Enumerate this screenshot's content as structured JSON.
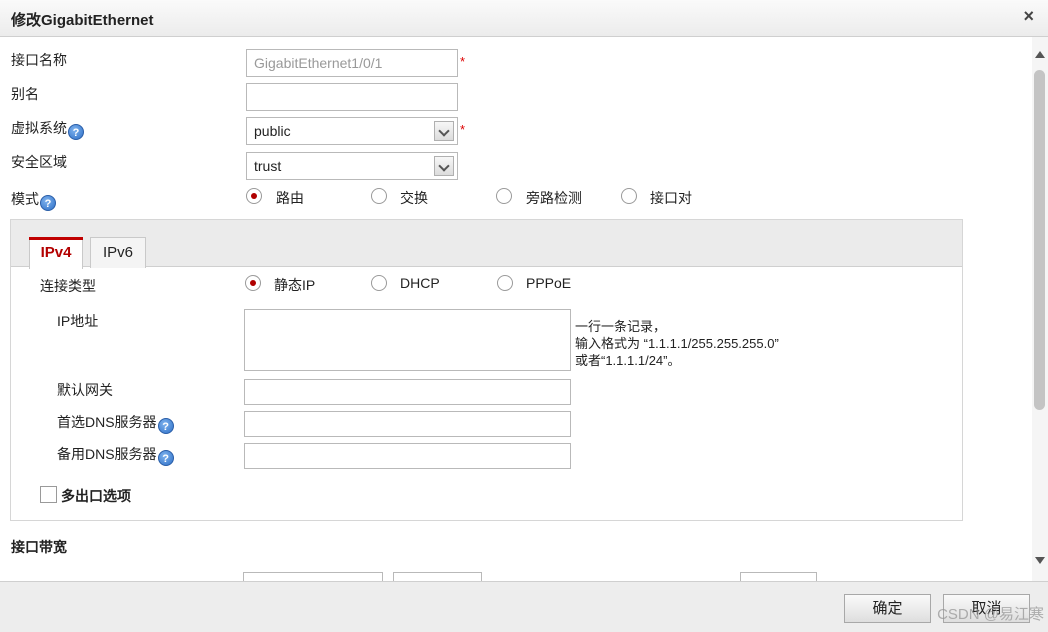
{
  "dialog": {
    "title": "修改GigabitEthernet",
    "close": "×"
  },
  "form": {
    "interface_name_label": "接口名称",
    "interface_name_value": "GigabitEthernet1/0/1",
    "alias_label": "别名",
    "alias_value": "",
    "vsys_label": "虚拟系统",
    "vsys_value": "public",
    "zone_label": "安全区域",
    "zone_value": "trust",
    "mode_label": "模式",
    "required_mark": "*",
    "help_glyph": "?",
    "mode_options": [
      "路由",
      "交换",
      "旁路检测",
      "接口对"
    ],
    "mode_selected": "路由"
  },
  "tabs": [
    {
      "label": "IPv4",
      "active": true
    },
    {
      "label": "IPv6",
      "active": false
    }
  ],
  "ipv4": {
    "conn_type_label": "连接类型",
    "conn_options": [
      "静态IP",
      "DHCP",
      "PPPoE"
    ],
    "conn_selected": "静态IP",
    "ip_label": "IP地址",
    "ip_hint_1": "一行一条记录，",
    "ip_hint_2": "输入格式为 “1.1.1.1/255.255.255.0”",
    "ip_hint_3": "或者“1.1.1.1/24”。",
    "gateway_label": "默认网关",
    "dns1_label": "首选DNS服务器",
    "dns2_label": "备用DNS服务器",
    "multi_exit_label": "多出口选项"
  },
  "bandwidth": {
    "title": "接口带宽"
  },
  "footer": {
    "ok": "确定",
    "cancel": "取消",
    "watermark": "CSDN @易江寒"
  }
}
